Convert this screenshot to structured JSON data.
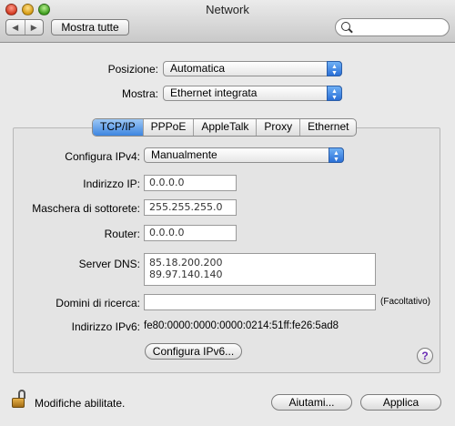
{
  "window": {
    "title": "Network"
  },
  "toolbar": {
    "back_icon": "◀",
    "forward_icon": "▶",
    "show_all_label": "Mostra tutte",
    "search_placeholder": ""
  },
  "location": {
    "label": "Posizione:",
    "value": "Automatica"
  },
  "show": {
    "label": "Mostra:",
    "value": "Ethernet integrata"
  },
  "tabs": [
    {
      "label": "TCP/IP",
      "active": true
    },
    {
      "label": "PPPoE"
    },
    {
      "label": "AppleTalk"
    },
    {
      "label": "Proxy"
    },
    {
      "label": "Ethernet"
    }
  ],
  "tcpip": {
    "configure_label": "Configura IPv4:",
    "configure_value": "Manualmente",
    "ip_label": "Indirizzo IP:",
    "ip_value": "0.0.0.0",
    "subnet_label": "Maschera di sottorete:",
    "subnet_value": "255.255.255.0",
    "router_label": "Router:",
    "router_value": "0.0.0.0",
    "dns_label": "Server DNS:",
    "dns_servers": [
      "85.18.200.200",
      "89.97.140.140"
    ],
    "search_domains_label": "Domini di ricerca:",
    "search_domains_value": "",
    "optional_label": "(Facoltativo)",
    "ipv6_label": "Indirizzo IPv6:",
    "ipv6_value": "fe80:0000:0000:0000:0214:51ff:fe26:5ad8",
    "configure_ipv6_button": "Configura IPv6...",
    "help_icon": "?"
  },
  "footer": {
    "lock_status": "Modifiche abilitate.",
    "assist_button": "Aiutami...",
    "apply_button": "Applica"
  },
  "colors": {
    "accent": "#3d85e0",
    "help_glyph": "#6a2db5"
  }
}
